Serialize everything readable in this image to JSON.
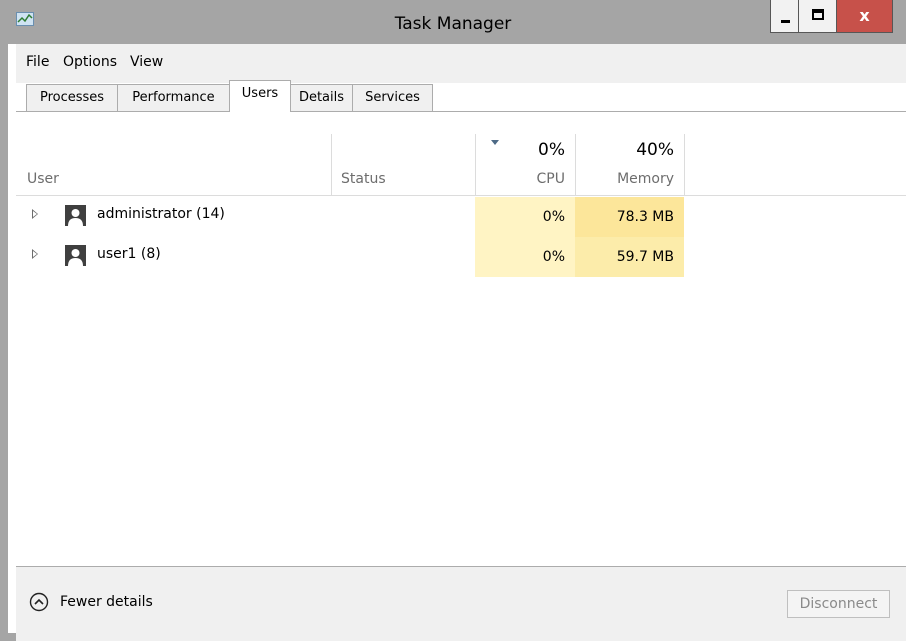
{
  "window": {
    "title": "Task Manager",
    "close_label": "x"
  },
  "menu": {
    "items": [
      "File",
      "Options",
      "View"
    ]
  },
  "tabs": [
    {
      "label": "Processes",
      "active": false
    },
    {
      "label": "Performance",
      "active": false
    },
    {
      "label": "Users",
      "active": true
    },
    {
      "label": "Details",
      "active": false
    },
    {
      "label": "Services",
      "active": false
    }
  ],
  "columns": {
    "user": "User",
    "status": "Status",
    "cpu": {
      "label": "CPU",
      "total": "0%"
    },
    "memory": {
      "label": "Memory",
      "total": "40%"
    }
  },
  "users": [
    {
      "name": "administrator (14)",
      "status": "",
      "cpu": "0%",
      "memory": "78.3 MB",
      "memory_color": "#fce69a"
    },
    {
      "name": "user1 (8)",
      "status": "",
      "cpu": "0%",
      "memory": "59.7 MB",
      "memory_color": "#fcecaa"
    }
  ],
  "footer": {
    "fewer_details": "Fewer details",
    "disconnect": "Disconnect"
  },
  "colors": {
    "titlebar": "#a5a5a5",
    "close_button": "#c7514a",
    "cpu_cell": "#fff4c4"
  }
}
